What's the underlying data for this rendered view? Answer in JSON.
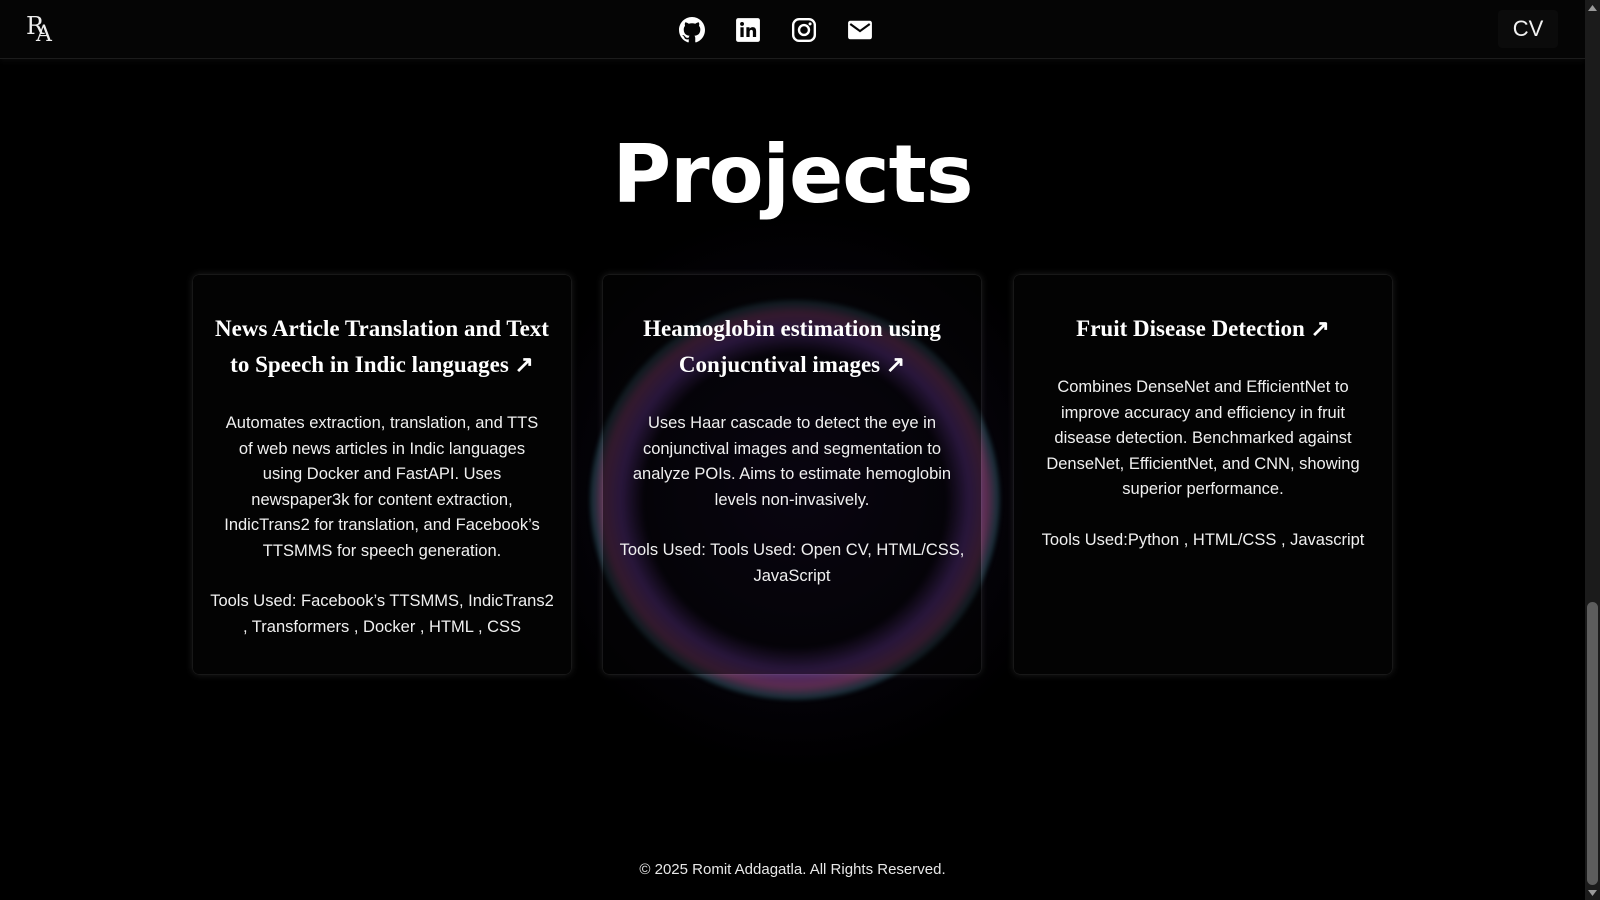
{
  "nav": {
    "logo": {
      "r": "R",
      "a": "A"
    },
    "socials": [
      {
        "icon": "github-icon"
      },
      {
        "icon": "linkedin-icon"
      },
      {
        "icon": "instagram-icon"
      },
      {
        "icon": "mail-icon"
      }
    ],
    "cv_label": "CV"
  },
  "main": {
    "heading": "Projects",
    "projects": [
      {
        "title": "News Article Translation and Text to Speech in Indic languages ↗",
        "description": "Automates extraction, translation, and TTS of web news articles in Indic languages using Docker and FastAPI. Uses newspaper3k for content extraction, IndicTrans2 for translation, and Facebook’s TTSMMS for speech generation.",
        "tools": "Tools Used: Facebook’s TTSMMS, IndicTrans2 , Transformers , Docker , HTML , CSS"
      },
      {
        "title": "Heamoglobin estimation using Conjucntival images ↗",
        "description": "Uses Haar cascade to detect the eye in conjunctival images and segmentation to analyze POIs. Aims to estimate hemoglobin levels non-invasively.",
        "tools": "Tools Used: Tools Used: Open CV, HTML/CSS, JavaScript"
      },
      {
        "title": "Fruit Disease Detection ↗",
        "description": "Combines DenseNet and EfficientNet to improve accuracy and efficiency in fruit disease detection. Benchmarked against DenseNet, EfficientNet, and CNN, showing superior performance.",
        "tools": "Tools Used:Python , HTML/CSS , Javascript"
      }
    ]
  },
  "footer": {
    "copyright": "© 2025 Romit Addagatla. All Rights Reserved."
  },
  "colors": {
    "background": "#000000",
    "text": "#ffffff",
    "glow_purple": "#9650dc",
    "glow_pink": "#ff78d2"
  }
}
